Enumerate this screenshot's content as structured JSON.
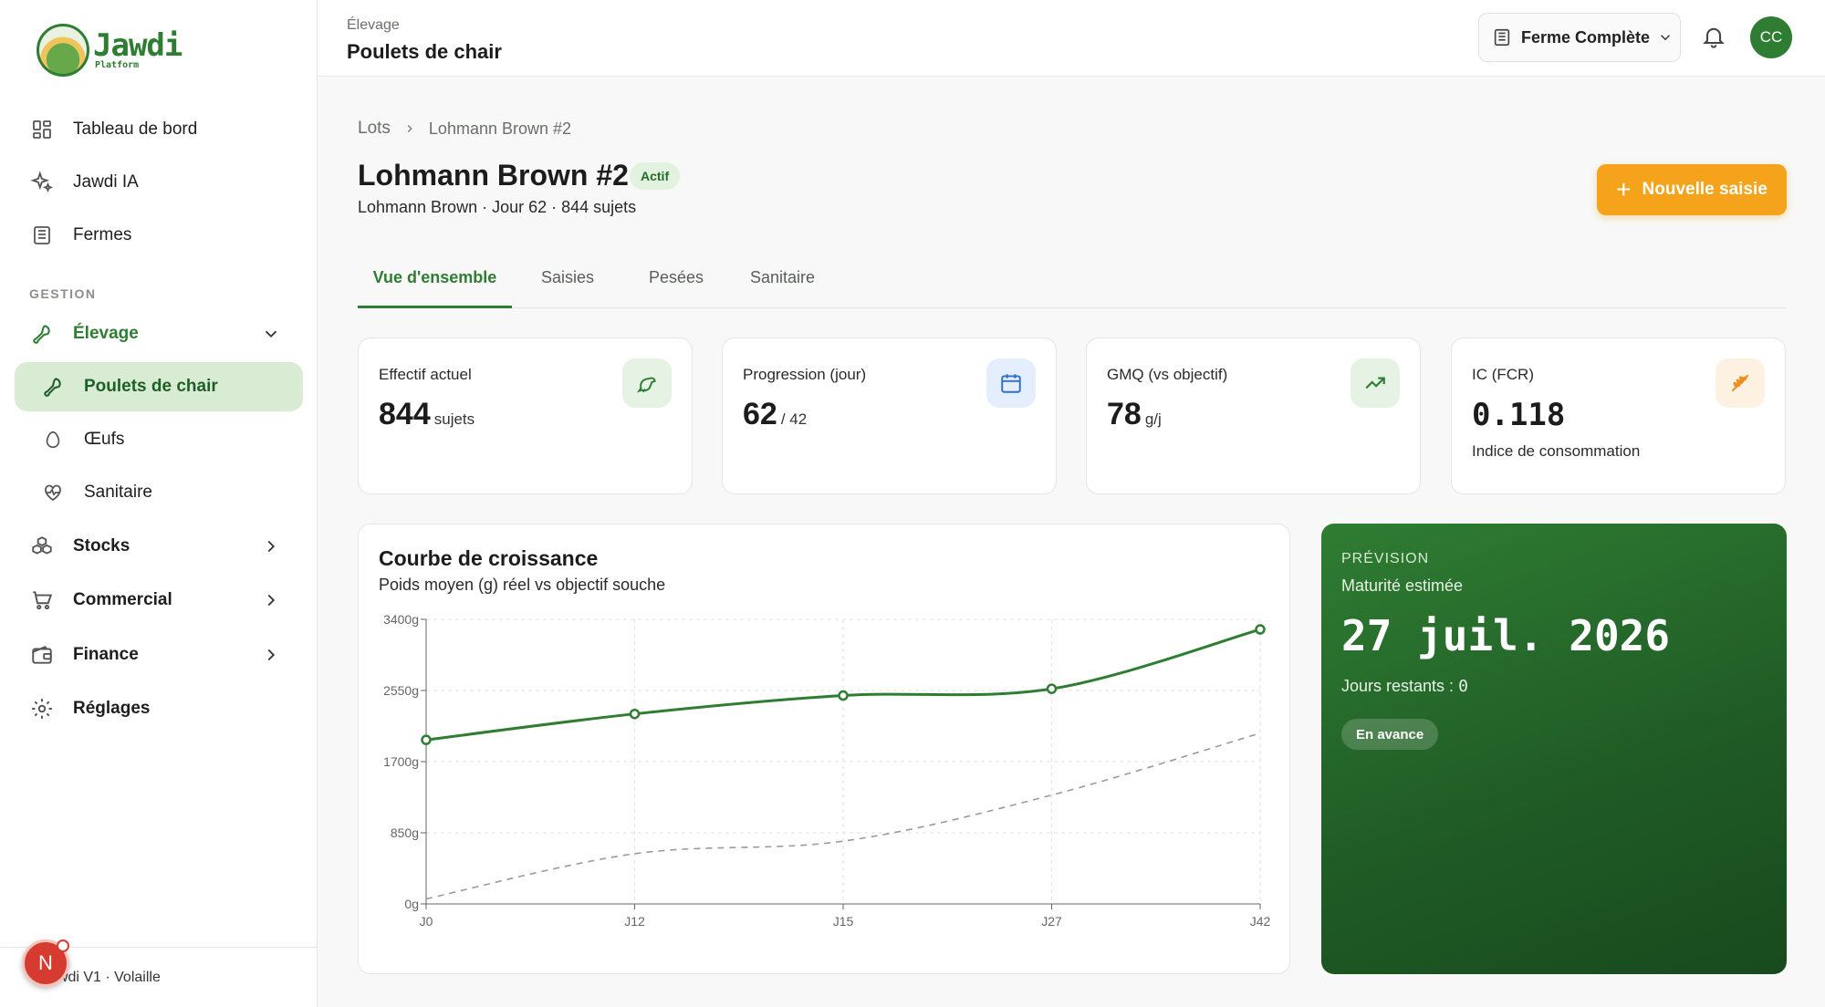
{
  "brand": {
    "name": "Jawdi",
    "sub": "Platform"
  },
  "sidebar": {
    "items": [
      {
        "label": "Tableau de bord",
        "icon": "dashboard-icon"
      },
      {
        "label": "Jawdi IA",
        "icon": "sparkles-icon"
      },
      {
        "label": "Fermes",
        "icon": "building-icon"
      }
    ],
    "section": "GESTION",
    "elevage": "Élevage",
    "sub_items": [
      {
        "label": "Poulets de chair",
        "icon": "chicken-leg-icon"
      },
      {
        "label": "Œufs",
        "icon": "egg-icon"
      },
      {
        "label": "Sanitaire",
        "icon": "heart-pulse-icon"
      }
    ],
    "groups": [
      {
        "label": "Stocks",
        "icon": "boxes-icon"
      },
      {
        "label": "Commercial",
        "icon": "cart-icon"
      },
      {
        "label": "Finance",
        "icon": "wallet-icon"
      }
    ],
    "settings": "Réglages",
    "footer": "Jawdi V1 · Volaille",
    "fab_letter": "N"
  },
  "topbar": {
    "subtitle": "Élevage",
    "title": "Poulets de chair",
    "farm": "Ferme Complète",
    "avatar": "CC"
  },
  "breadcrumb": {
    "root": "Lots",
    "current": "Lohmann Brown #2"
  },
  "lot": {
    "title": "Lohmann Brown #2",
    "status": "Actif",
    "subtitle": "Lohmann Brown · Jour 62 · 844 sujets",
    "new_button": "Nouvelle saisie"
  },
  "tabs": [
    "Vue d'ensemble",
    "Saisies",
    "Pesées",
    "Sanitaire"
  ],
  "kpis": [
    {
      "label": "Effectif actuel",
      "value": "844",
      "unit": "sujets",
      "icon": "bird-icon",
      "color": "#2e7d32",
      "bg": "#e6f2e4"
    },
    {
      "label": "Progression (jour)",
      "value": "62",
      "unit": "/ 42",
      "icon": "calendar-icon",
      "color": "#2f6fd0",
      "bg": "#e4eefc"
    },
    {
      "label": "GMQ (vs objectif)",
      "value": "78",
      "unit": "g/j",
      "icon": "trend-up-icon",
      "color": "#2e7d32",
      "bg": "#e6f2e4"
    },
    {
      "label": "IC (FCR)",
      "value": "0.118",
      "note": "Indice de consommation",
      "icon": "wheat-icon",
      "color": "#f08c1a",
      "bg": "#fdf1e2"
    }
  ],
  "chart": {
    "title": "Courbe de croissance",
    "subtitle": "Poids moyen (g) réel vs objectif souche"
  },
  "chart_data": {
    "type": "line",
    "categories": [
      "J0",
      "J12",
      "J15",
      "J27",
      "J42"
    ],
    "x": [
      0,
      12,
      15,
      27,
      42
    ],
    "ylim": [
      0,
      3400
    ],
    "yticks": [
      "0g",
      "850g",
      "1700g",
      "2550g",
      "3400g"
    ],
    "series": [
      {
        "values": [
          1960,
          2270,
          2490,
          2570,
          3280
        ],
        "color": "#2e7d32",
        "style": "solid"
      },
      {
        "values": [
          60,
          600,
          750,
          1300,
          2040
        ],
        "color": "#9a9a9a",
        "style": "dashed"
      }
    ],
    "grid": true
  },
  "forecast": {
    "kicker": "PRÉVISION",
    "label": "Maturité estimée",
    "date": "27 juil. 2026",
    "days_label": "Jours restants :",
    "days_value": "0",
    "pill": "En avance"
  }
}
